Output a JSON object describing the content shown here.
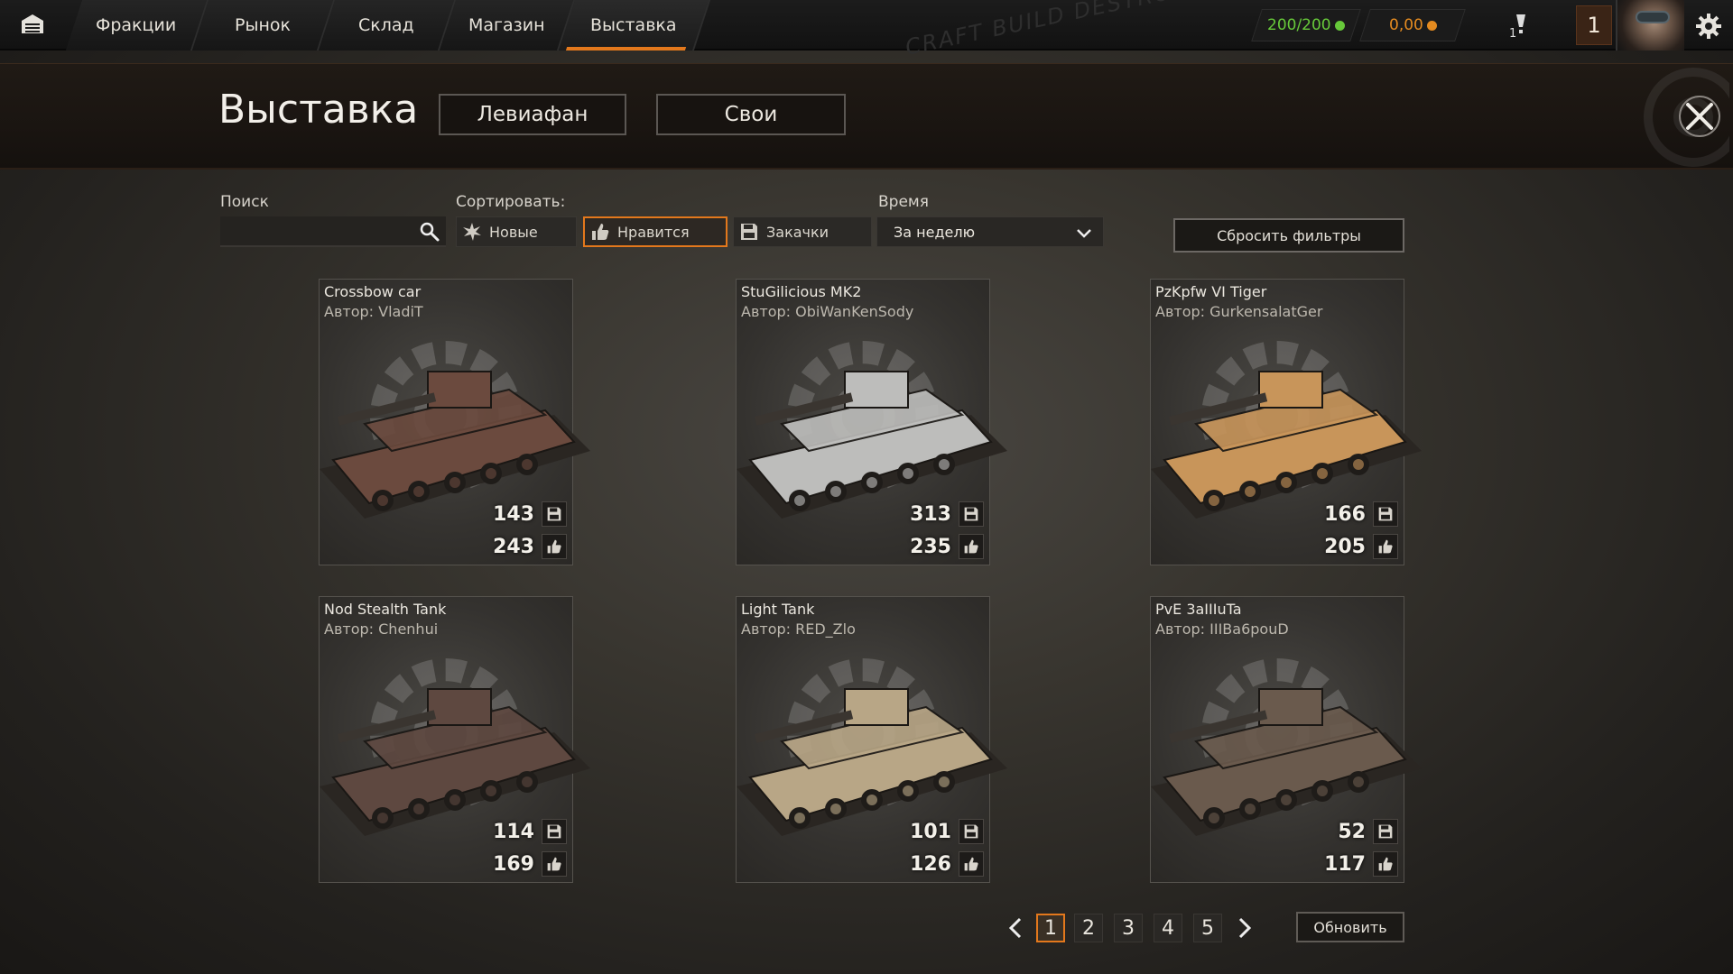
{
  "nav": {
    "tabs": [
      {
        "label": "Фракции"
      },
      {
        "label": "Рынок"
      },
      {
        "label": "Склад"
      },
      {
        "label": "Магазин"
      },
      {
        "label": "Выставка"
      }
    ],
    "active_tab": "Выставка",
    "graffiti": "CRAFT BUILD DESTROY"
  },
  "resources": {
    "fuel": "200/200",
    "coins": "0,00",
    "badge_count": "1",
    "level": "1"
  },
  "header": {
    "title": "Выставка",
    "leviathan_button": "Левиафан",
    "own_button": "Свои"
  },
  "filters": {
    "search_label": "Поиск",
    "search_value": "",
    "sort_label": "Сортировать:",
    "sort_options": [
      {
        "label": "Новые",
        "icon": "sunburst-icon"
      },
      {
        "label": "Нравится",
        "icon": "thumbs-up-icon"
      },
      {
        "label": "Закачки",
        "icon": "save-icon"
      }
    ],
    "active_sort": "Нравится",
    "time_label": "Время",
    "time_value": "За неделю",
    "reset_button": "Сбросить фильтры"
  },
  "author_prefix": "Автор:",
  "cards": [
    {
      "name": "Crossbow car",
      "author": "VladiT",
      "downloads": "143",
      "likes": "243",
      "color": "#6b4a3e"
    },
    {
      "name": "StuGilicious MK2",
      "author": "ObiWanKenSody",
      "downloads": "313",
      "likes": "235",
      "color": "#bdbdbb"
    },
    {
      "name": "PzKpfw VI Tiger",
      "author": "GurkensalatGer",
      "downloads": "166",
      "likes": "205",
      "color": "#c8955a"
    },
    {
      "name": "Nod Stealth Tank",
      "author": "Chenhui",
      "downloads": "114",
      "likes": "169",
      "color": "#5e4840"
    },
    {
      "name": "Light Tank",
      "author": "RED_Zlo",
      "downloads": "101",
      "likes": "126",
      "color": "#b8a686"
    },
    {
      "name": "PvE 3aIIIuTa",
      "author": "IIIBa6pouD",
      "downloads": "52",
      "likes": "117",
      "color": "#6a5a4d"
    }
  ],
  "pagination": {
    "pages": [
      "1",
      "2",
      "3",
      "4",
      "5"
    ],
    "current": "1",
    "refresh_button": "Обновить"
  },
  "colors": {
    "accent": "#e3781c",
    "fuel": "#67c93a",
    "coins": "#e58b20"
  }
}
